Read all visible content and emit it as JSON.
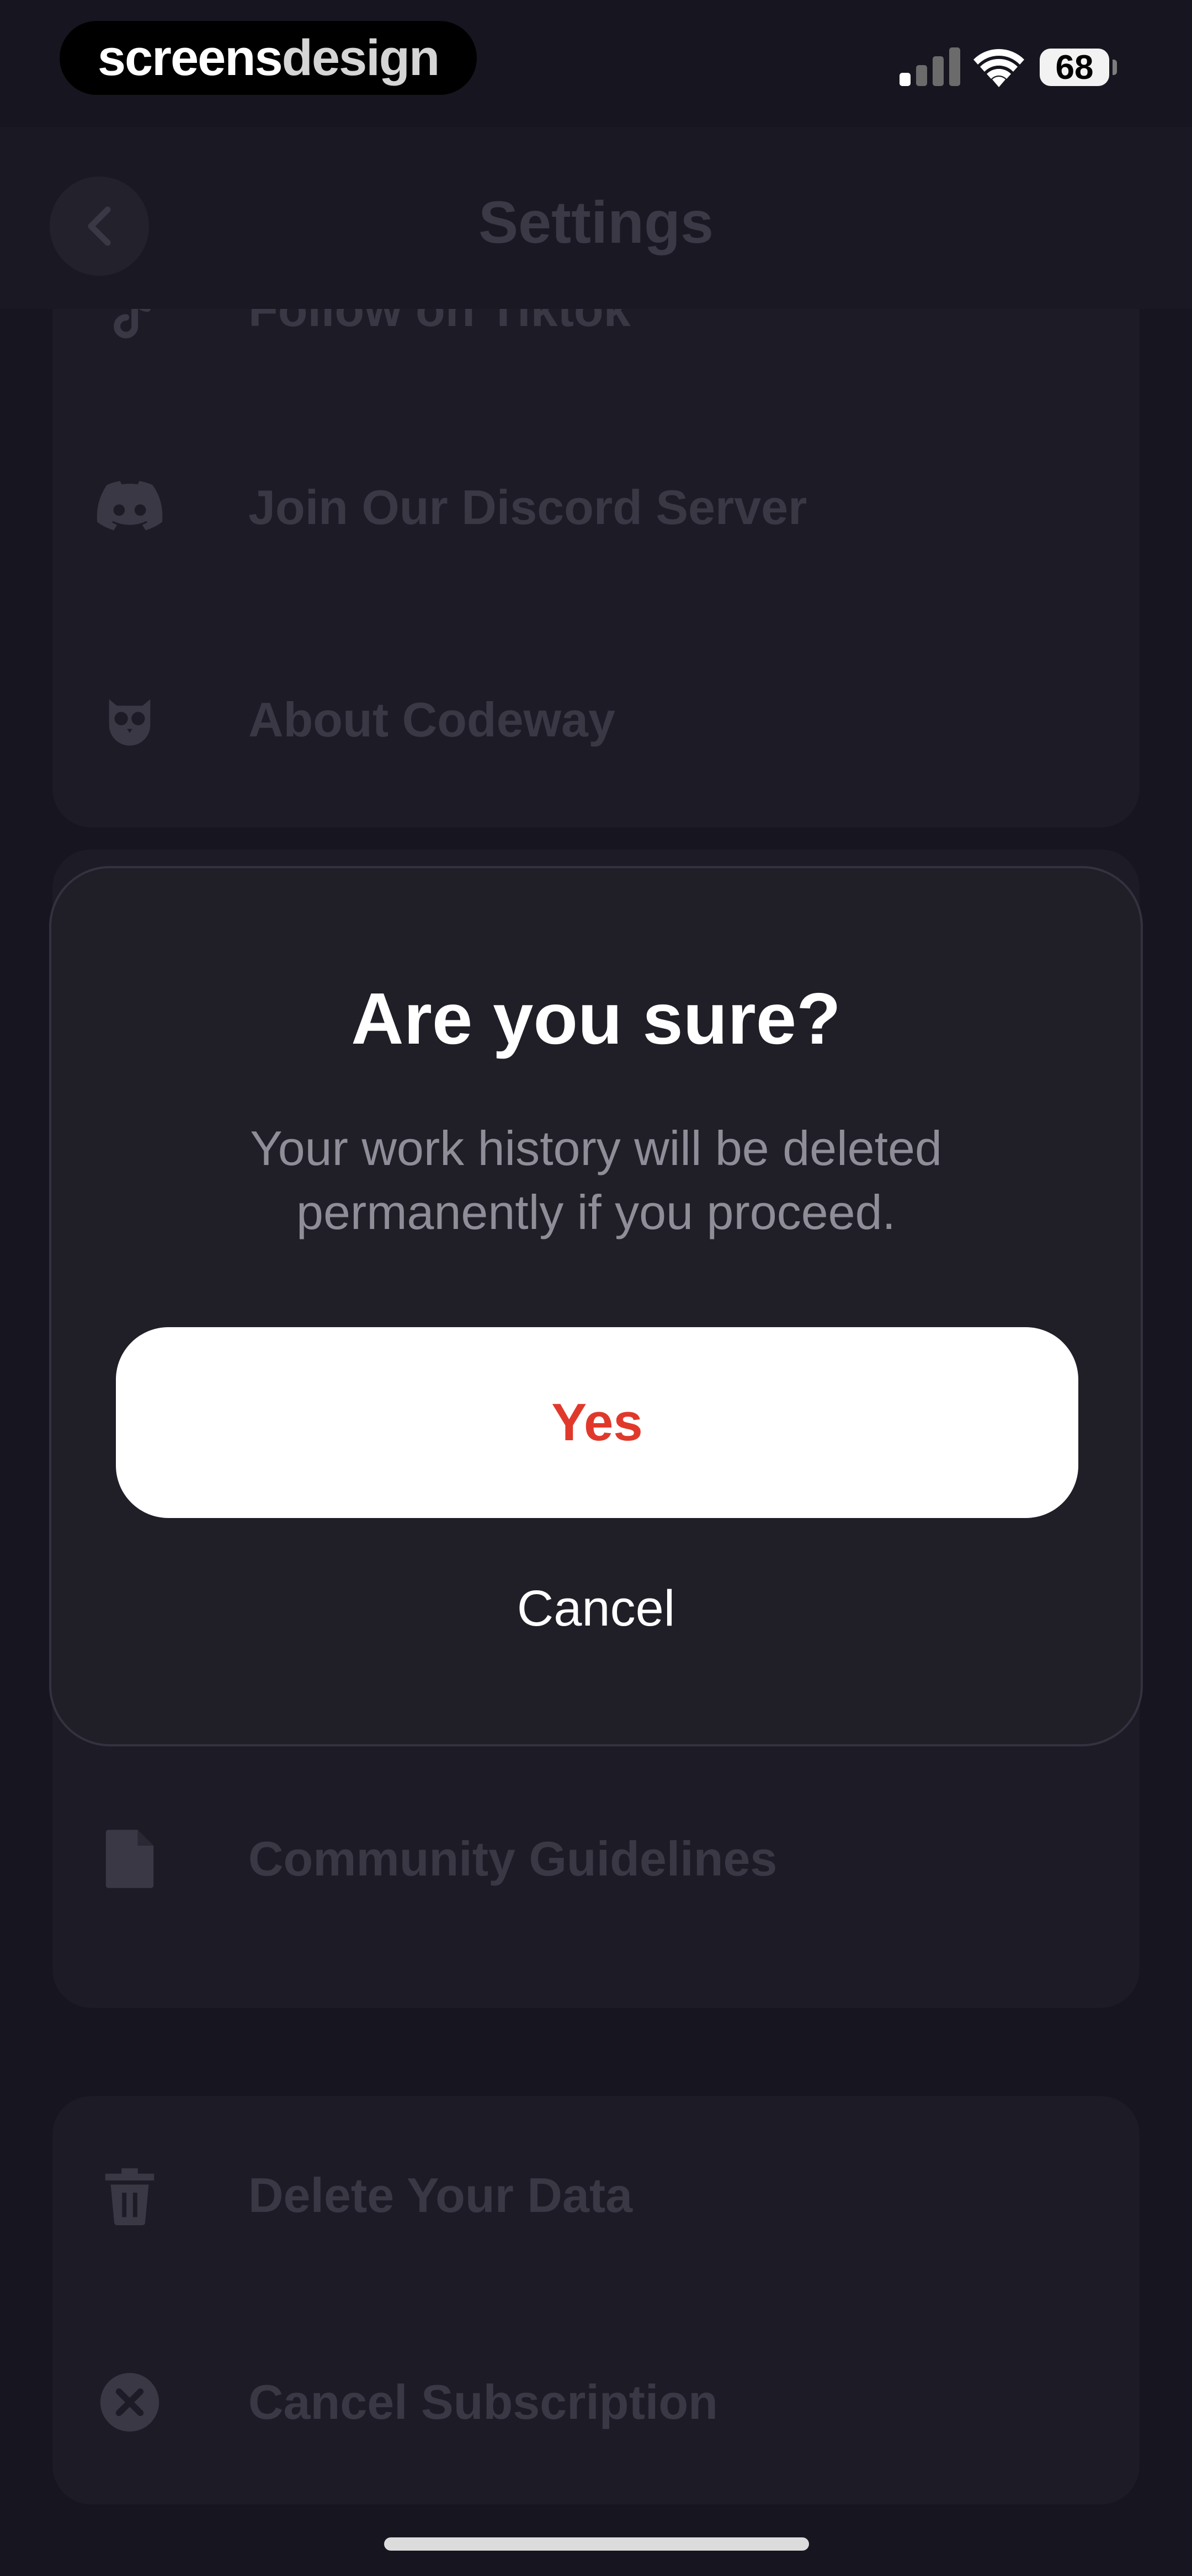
{
  "status_bar": {
    "brand_part1": "screens",
    "brand_part2": "design",
    "battery": "68"
  },
  "header": {
    "title": "Settings"
  },
  "settings": {
    "social_items": [
      {
        "label": "Follow on Tiktok",
        "icon": "tiktok-icon"
      },
      {
        "label": "Join Our Discord Server",
        "icon": "discord-icon"
      },
      {
        "label": "About Codeway",
        "icon": "owl-icon"
      }
    ],
    "legal_items": [
      {
        "label": "Community Guidelines",
        "icon": "document-icon"
      }
    ],
    "account_items": [
      {
        "label": "Delete Your Data",
        "icon": "trash-icon"
      },
      {
        "label": "Cancel Subscription",
        "icon": "close-circle-icon"
      }
    ]
  },
  "dialog": {
    "title": "Are you sure?",
    "message": "Your work history will be deleted permanently if you proceed.",
    "confirm_label": "Yes",
    "cancel_label": "Cancel"
  },
  "colors": {
    "background": "#17151f",
    "dialog_background": "#201f28",
    "confirm_text": "#e0392c",
    "dimmed_text": "#3a3844"
  }
}
